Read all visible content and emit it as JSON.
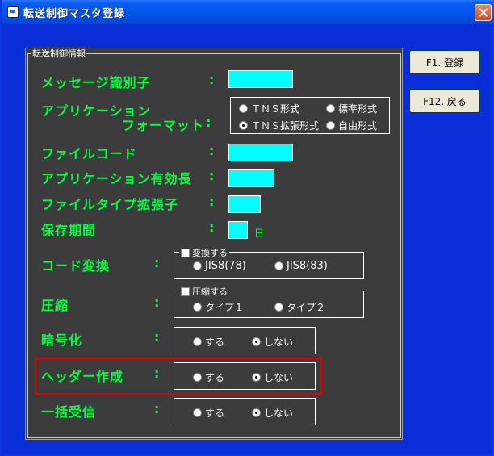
{
  "window": {
    "title": "転送制御マスタ登録"
  },
  "group": {
    "label": "転送制御情報"
  },
  "fields": {
    "message_id": {
      "label": "メッセージ識別子",
      "colon": ":",
      "value": ""
    },
    "app_format": {
      "label_line1": "アプリケーション",
      "label_line2": "フォーマット",
      "colon": ":",
      "options": [
        "ＴＮＳ形式",
        "標準形式",
        "ＴＮＳ拡張形式",
        "自由形式"
      ],
      "selected": "ＴＮＳ拡張形式"
    },
    "file_code": {
      "label": "ファイルコード",
      "colon": ":",
      "value": ""
    },
    "app_length": {
      "label": "アプリケーション有効長",
      "colon": ":",
      "value": ""
    },
    "file_ext": {
      "label": "ファイルタイプ拡張子",
      "colon": ":",
      "value": ""
    },
    "retention": {
      "label": "保存期間",
      "colon": ":",
      "value": "",
      "unit": "日"
    },
    "code_conv": {
      "label": "コード変換",
      "colon": ":",
      "check_label": "変換する",
      "options": [
        "JIS8(78)",
        "JIS8(83)"
      ]
    },
    "compress": {
      "label": "圧縮",
      "colon": ":",
      "check_label": "圧縮する",
      "options": [
        "タイプ１",
        "タイプ２"
      ]
    },
    "encrypt": {
      "label": "暗号化",
      "colon": ":",
      "options": [
        "する",
        "しない"
      ],
      "selected": "しない"
    },
    "header": {
      "label": "ヘッダー作成",
      "colon": ":",
      "options": [
        "する",
        "しない"
      ],
      "selected": "しない"
    },
    "batch_recv": {
      "label": "一括受信",
      "colon": ":",
      "options": [
        "する",
        "しない"
      ],
      "selected": "しない"
    }
  },
  "buttons": {
    "register": "F1. 登録",
    "back": "F12. 戻る"
  }
}
